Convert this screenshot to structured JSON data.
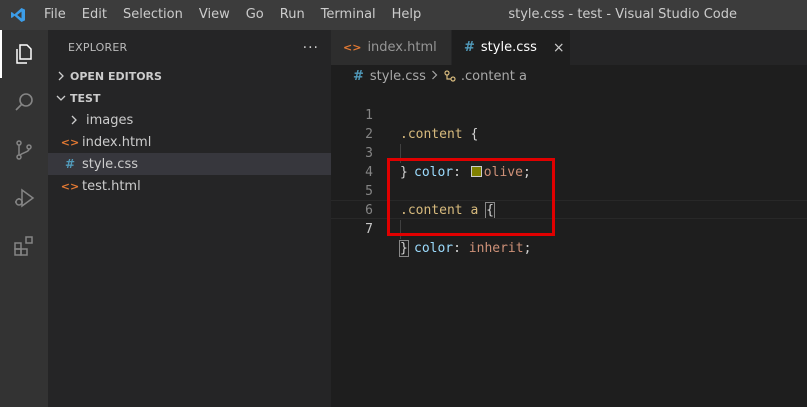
{
  "titlebar": {
    "menu": [
      "File",
      "Edit",
      "Selection",
      "View",
      "Go",
      "Run",
      "Terminal",
      "Help"
    ],
    "window_title": "style.css - test - Visual Studio Code"
  },
  "activitybar": {
    "items": [
      "explorer-icon",
      "search-icon",
      "source-control-icon",
      "run-debug-icon",
      "extensions-icon"
    ]
  },
  "sidebar": {
    "title": "EXPLORER",
    "more": "···",
    "open_editors": "OPEN EDITORS",
    "folder": "TEST",
    "items": [
      {
        "label": "images",
        "type": "folder"
      },
      {
        "label": "index.html",
        "type": "html"
      },
      {
        "label": "style.css",
        "type": "css"
      },
      {
        "label": "test.html",
        "type": "html"
      }
    ]
  },
  "tabs": [
    {
      "label": "index.html",
      "icon": "<>",
      "active": false
    },
    {
      "label": "style.css",
      "icon": "#",
      "active": true,
      "close": "×"
    }
  ],
  "breadcrumb": {
    "file": "style.css",
    "file_icon": "#",
    "symbol": ".content a"
  },
  "editor": {
    "line_numbers": [
      "1",
      "2",
      "3",
      "4",
      "5",
      "6",
      "7"
    ],
    "current_line": "7",
    "lines": {
      "l1": {
        "selector": ".content",
        "open": " {"
      },
      "l2": {
        "prop": "color",
        "colon": ": ",
        "value": "olive",
        "semi": ";"
      },
      "l3": {
        "close": "}"
      },
      "l5": {
        "selector": ".content a",
        "space": " ",
        "open": "{"
      },
      "l6": {
        "prop": "color",
        "colon": ": ",
        "value": "inherit",
        "semi": ";"
      },
      "l7": {
        "close": "}"
      }
    },
    "swatch_color": "#808000"
  },
  "colors": {
    "accent": "#007acc",
    "highlight_box": "#e00000"
  }
}
